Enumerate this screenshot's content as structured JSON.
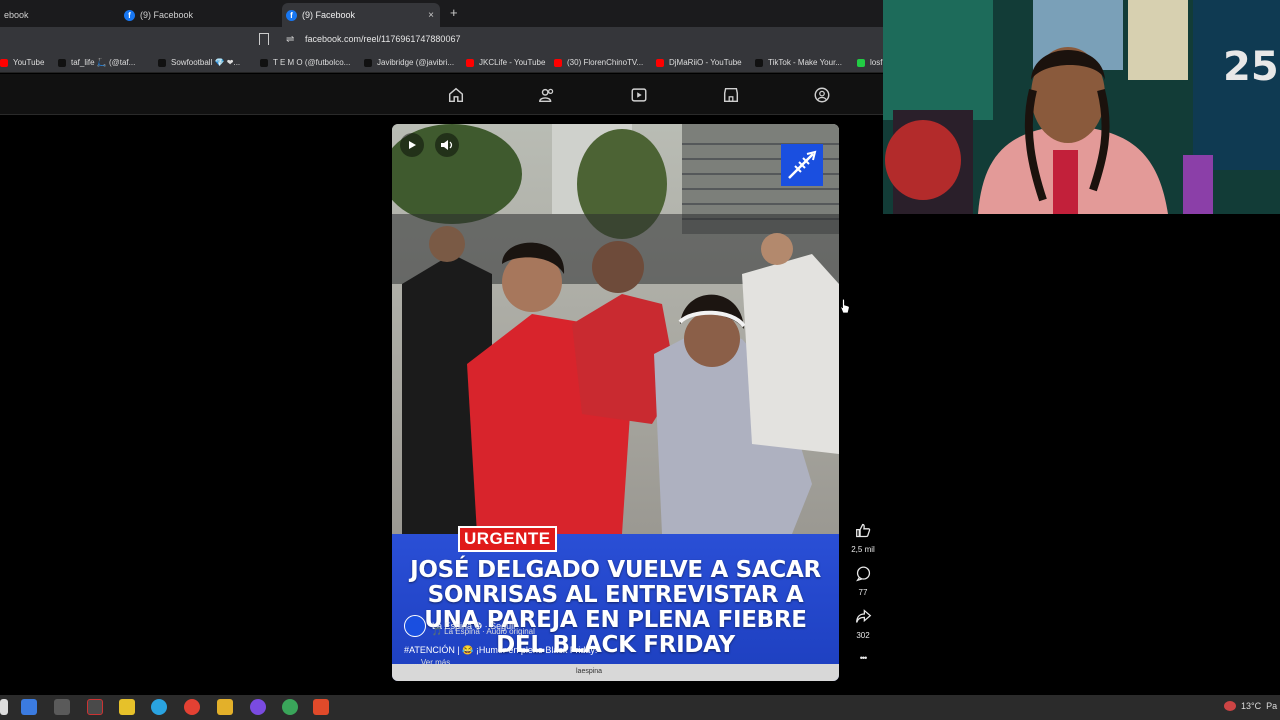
{
  "browser": {
    "tabs": [
      {
        "label": "ebook"
      },
      {
        "label": "(9) Facebook"
      },
      {
        "label": "(9) Facebook",
        "active": true
      }
    ],
    "close_glyph": "×",
    "newtab_glyph": "+",
    "url": "facebook.com/reel/1176961747880067"
  },
  "bookmarks": [
    {
      "label": "YouTube",
      "color": "#ff0000"
    },
    {
      "label": "taf_life 🛴 (@taf...",
      "color": "#111111"
    },
    {
      "label": "Sowfootball 💎 ❤...",
      "color": "#111111"
    },
    {
      "label": "T E M O (@futbolco...",
      "color": "#111111"
    },
    {
      "label": "Javibridge (@javibri...",
      "color": "#111111"
    },
    {
      "label": "JKCLife - YouTube",
      "color": "#ff0000"
    },
    {
      "label": "(30) FlorenChinoTV...",
      "color": "#ff0000"
    },
    {
      "label": "DjMaRiiO - YouTube",
      "color": "#ff0000"
    },
    {
      "label": "TikTok - Make Your...",
      "color": "#111111"
    },
    {
      "label": "losf",
      "color": "#22cc44"
    }
  ],
  "fb_nav": {
    "icons": [
      "home-icon",
      "friends-icon",
      "video-icon",
      "marketplace-icon",
      "groups-icon"
    ]
  },
  "reel": {
    "badge": "URGENTE",
    "headline": "JOSÉ DELGADO VUELVE A SACAR SONRISAS AL ENTREVISTAR A UNA PAREJA EN PLENA FIEBRE DEL BLACK FRIDAY",
    "author": "La Espina ✪ · Seguir",
    "audio": "🎵 La Espina · Audio original",
    "caption": "#ATENCIÓN | 😂 ¡Humor en pleno Black Friday!",
    "see_more": "... Ver más",
    "footer": "laespina",
    "brand_color": "#1a4fe0"
  },
  "actions": {
    "likes": "2,5 mil",
    "comments": "77",
    "shares": "302",
    "more": "•••"
  },
  "taskbar": {
    "weather": "13°C",
    "weather_suffix": "Pa"
  }
}
